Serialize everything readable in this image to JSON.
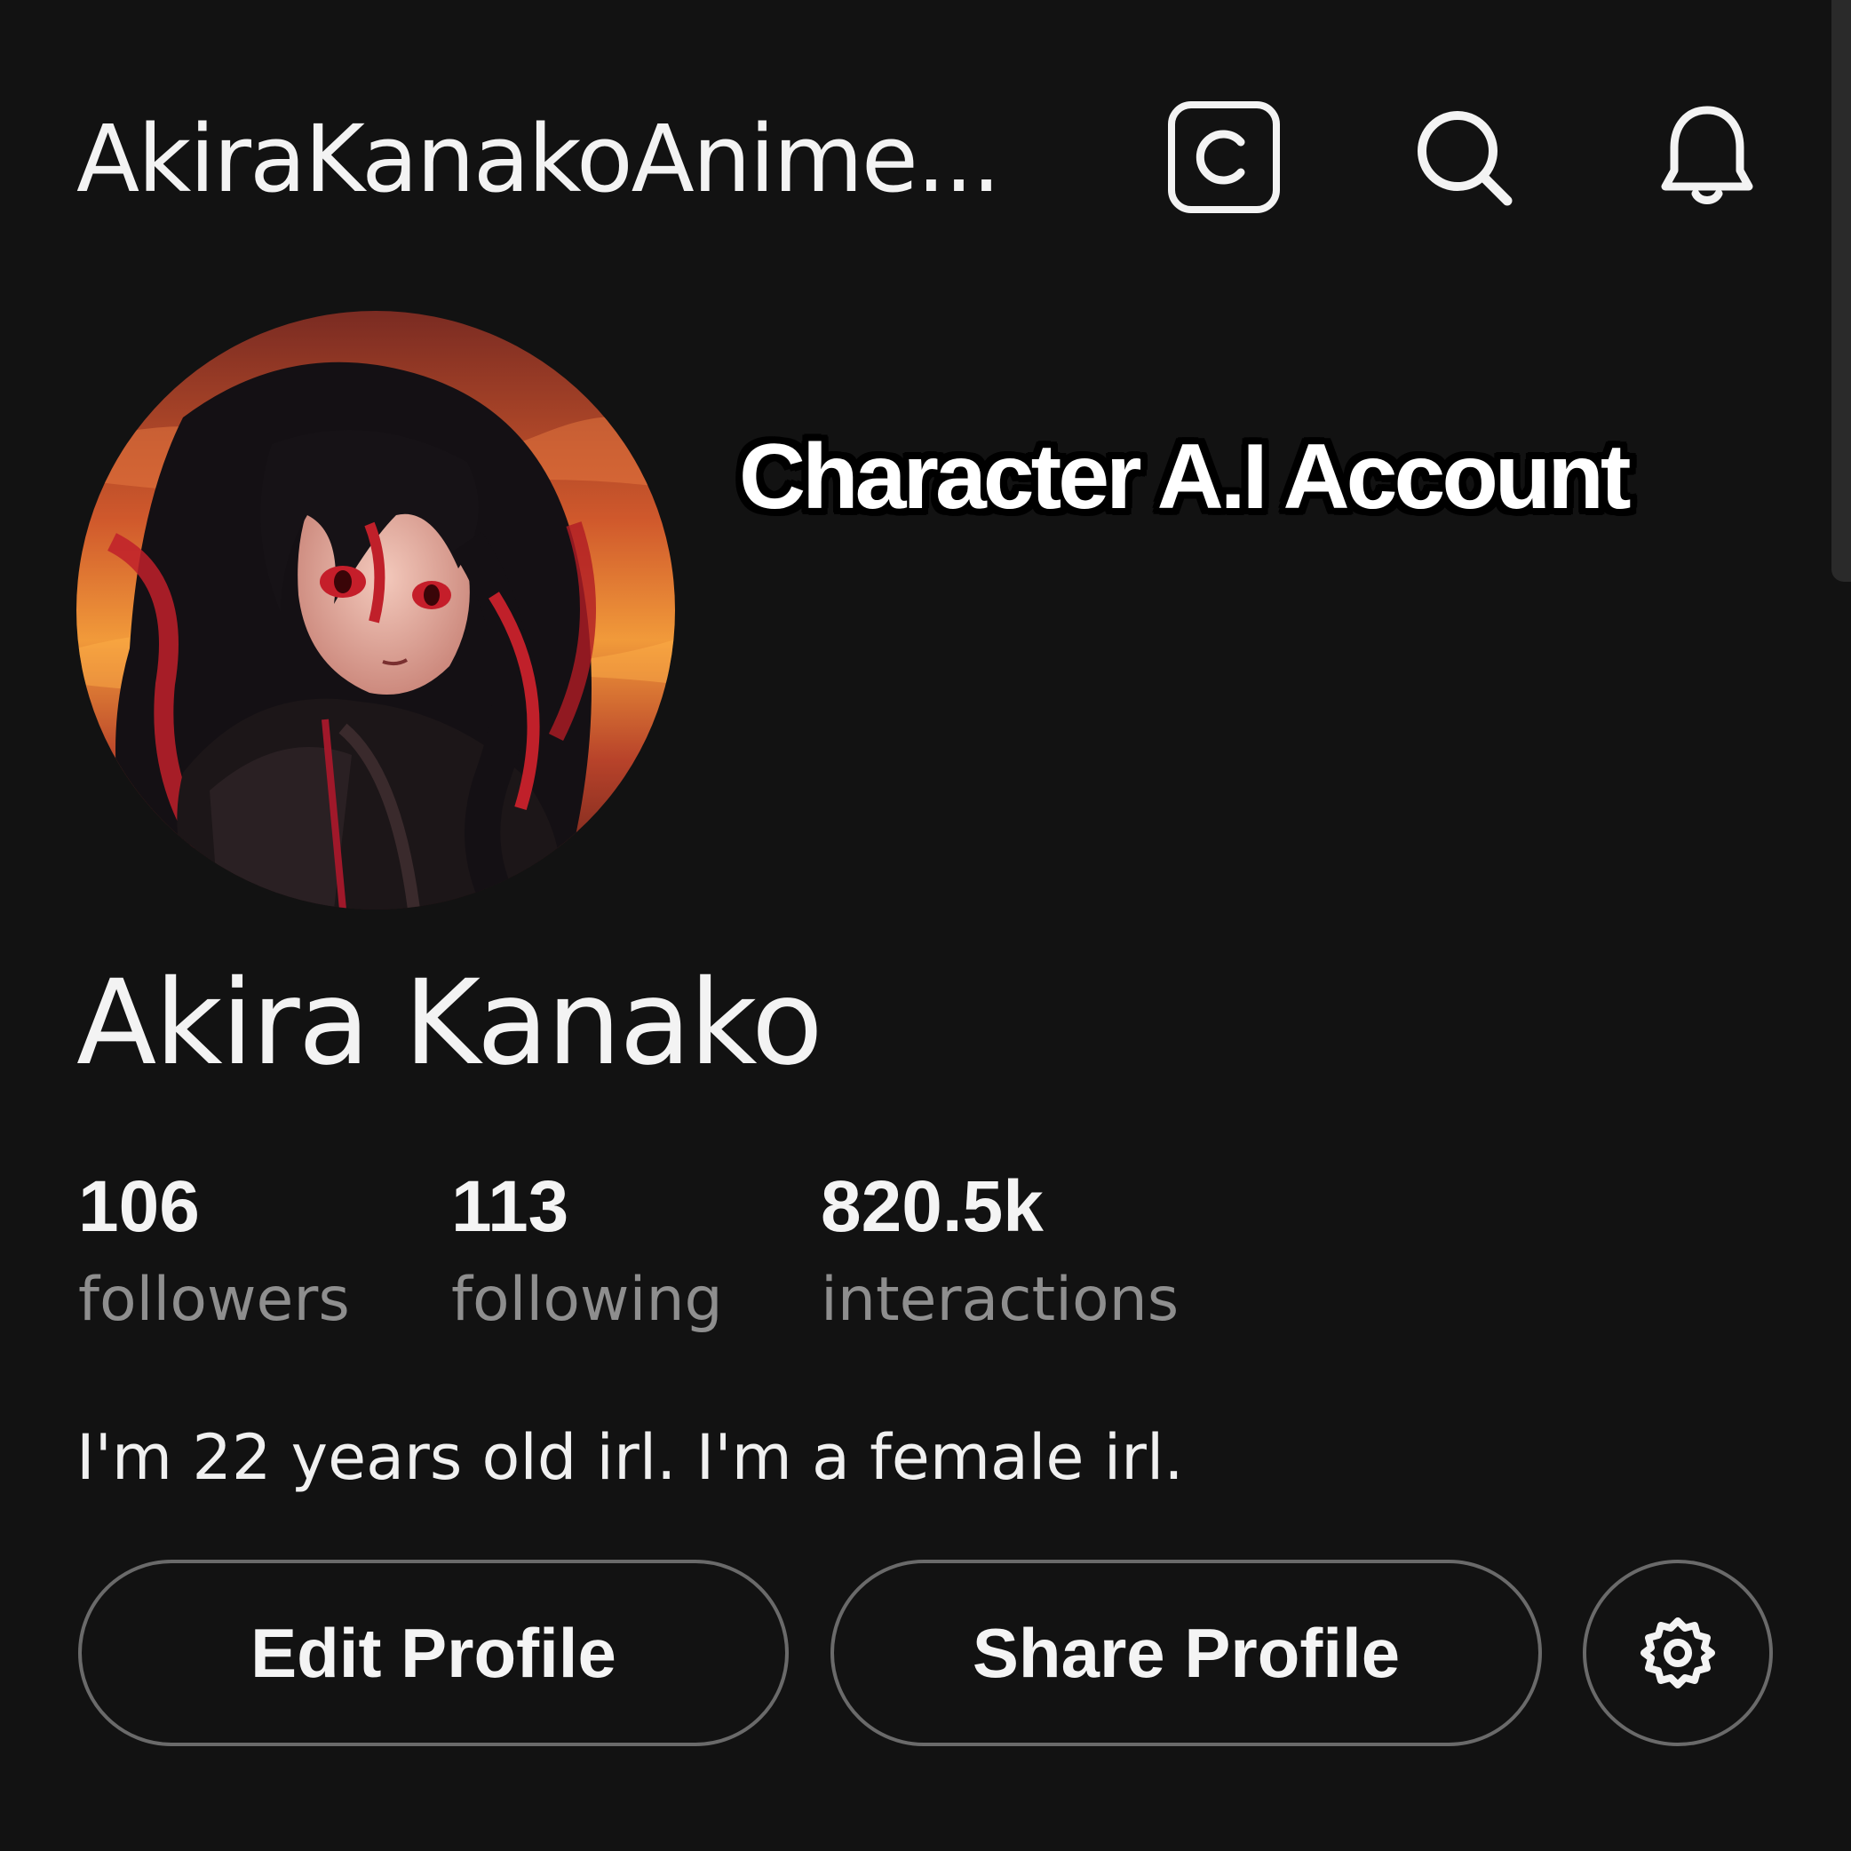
{
  "header": {
    "title": "AkiraKanakoAnime...",
    "icons": [
      "copyright-icon",
      "search-icon",
      "bell-icon"
    ]
  },
  "overlay": {
    "caption": "Character A.I Account"
  },
  "profile": {
    "display_name": "Akira Kanako",
    "avatar": "anime-girl-avatar",
    "bio": "I'm 22 years old irl. I'm a female irl."
  },
  "stats": {
    "followers": {
      "value": "106",
      "label": "followers"
    },
    "following": {
      "value": "113",
      "label": "following"
    },
    "interactions": {
      "value": "820.5k",
      "label": "interactions"
    }
  },
  "actions": {
    "edit_label": "Edit Profile",
    "share_label": "Share Profile",
    "settings_icon": "gear-icon"
  },
  "colors": {
    "background": "#121212",
    "text": "#f3f3f3",
    "muted": "#8e8e8e",
    "border": "#6a6a6a"
  }
}
